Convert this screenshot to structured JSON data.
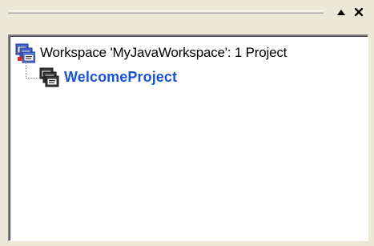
{
  "tree": {
    "items": [
      {
        "label": "Workspace 'MyJavaWorkspace': 1 Project",
        "icon": "workspace-icon"
      },
      {
        "label": "WelcomeProject",
        "icon": "project-icon",
        "selected": true
      }
    ]
  },
  "title_bar": {
    "maximize_icon": "triangle-up-icon",
    "close_icon": "close-icon"
  },
  "colors": {
    "panel_background": "#ece9d8",
    "tree_background": "#ffffff",
    "project_text": "#1a52d6",
    "workspace_text": "#000000"
  }
}
